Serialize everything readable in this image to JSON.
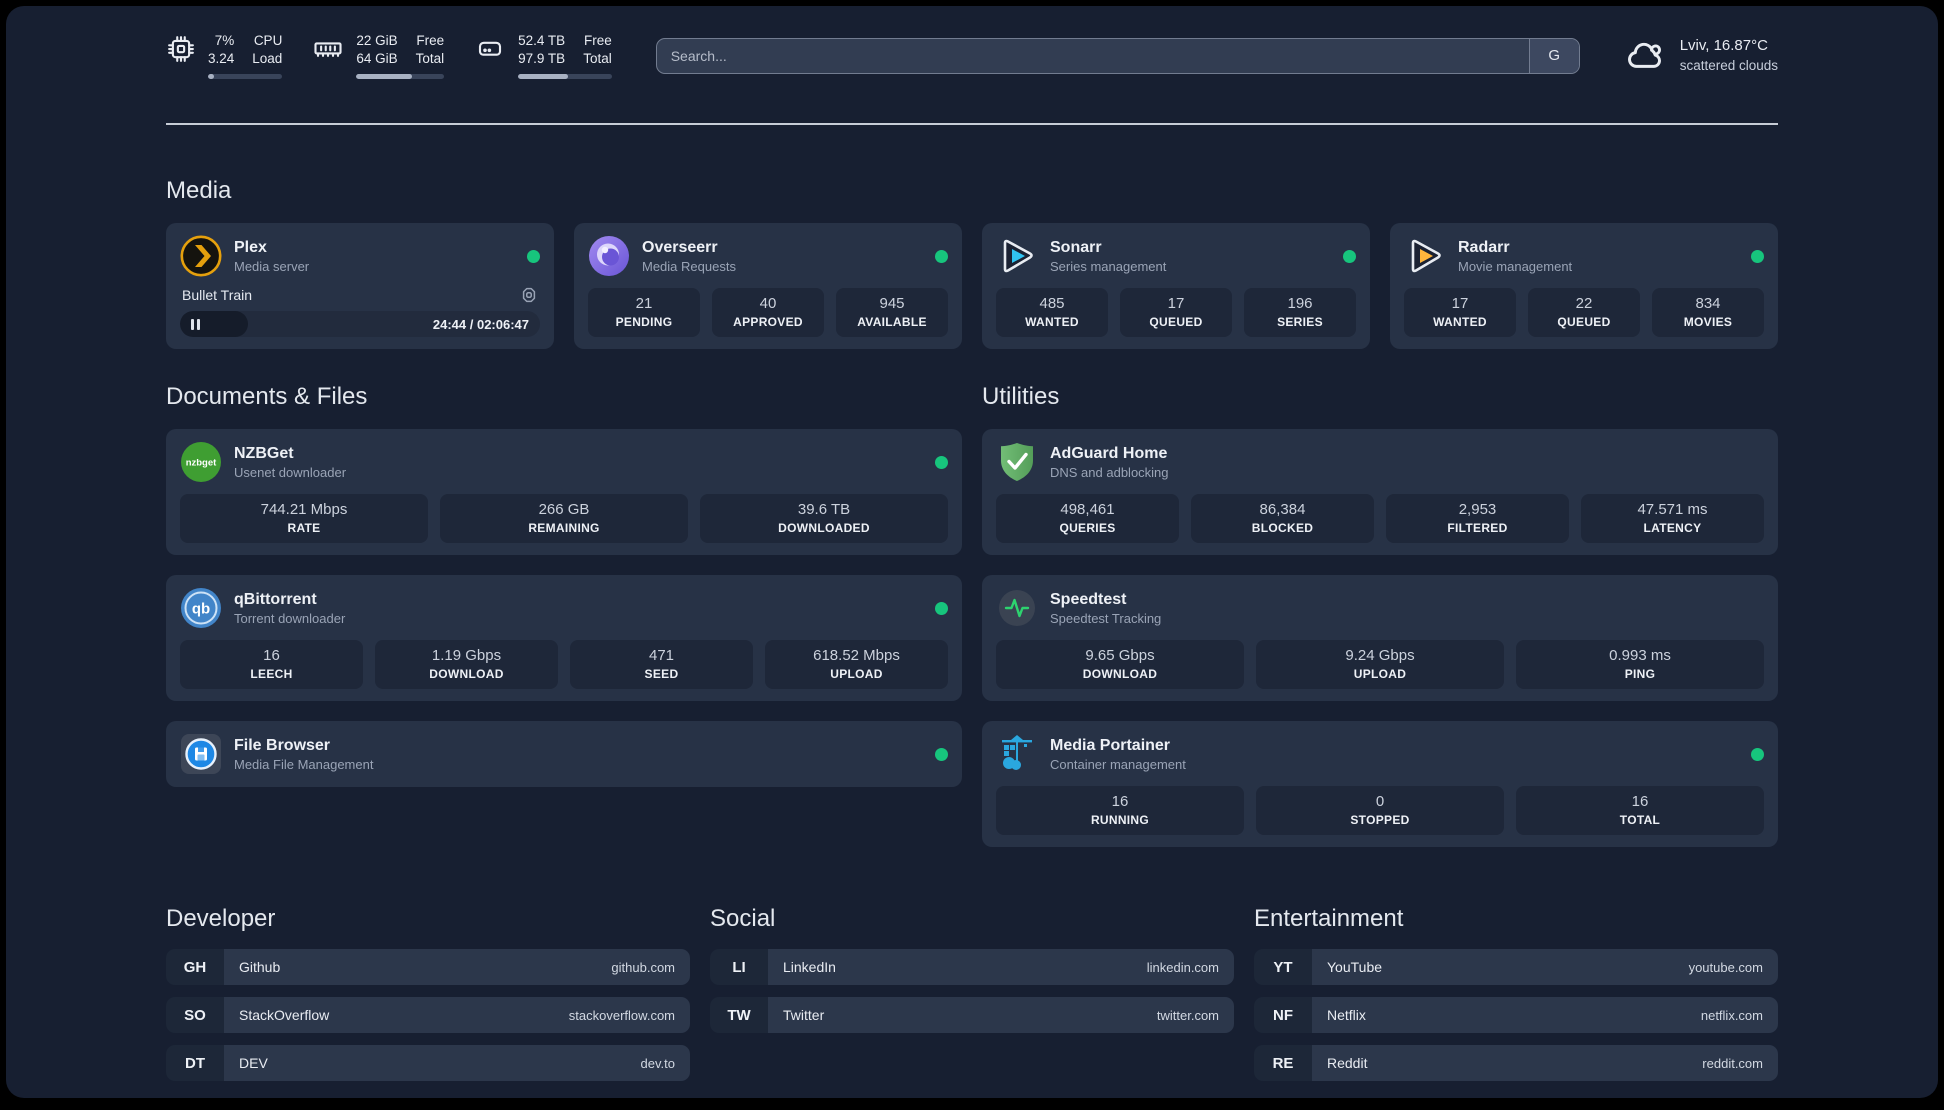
{
  "colors": {
    "background": "#171f31",
    "card": "#273246",
    "tile": "#1e2739",
    "status_green": "#17c57d",
    "plex_amber": "#e5a00d",
    "sonarr_cyan": "#30c4f2",
    "radarr_amber": "#ffb53c",
    "nzbget_green": "#3f9e32",
    "qbittorrent_blue": "#4285c9",
    "adguard_green": "#5fae63",
    "speedtest_green": "#2dd36f",
    "portainer_blue": "#2aa7df",
    "filebrowser_blue": "#1e88e5"
  },
  "topbar": {
    "cpu": {
      "icon": "cpu-icon",
      "v1": "7%",
      "v2": "3.24",
      "l1": "CPU",
      "l2": "Load",
      "progress": 8
    },
    "memory": {
      "icon": "ram-icon",
      "v1": "22 GiB",
      "v2": "64 GiB",
      "l1": "Free",
      "l2": "Total",
      "progress": 63
    },
    "disk": {
      "icon": "disk-icon",
      "v1": "52.4 TB",
      "v2": "97.9 TB",
      "l1": "Free",
      "l2": "Total",
      "progress": 53
    },
    "search": {
      "placeholder": "Search...",
      "button": "G"
    },
    "weather": {
      "line1": "Lviv, 16.87°C",
      "line2": "scattered clouds"
    }
  },
  "media": {
    "title": "Media",
    "plex": {
      "name": "Plex",
      "desc": "Media server",
      "player": {
        "title": "Bullet Train",
        "time": "24:44 / 02:06:47",
        "progress": 19
      }
    },
    "overseerr": {
      "name": "Overseerr",
      "desc": "Media Requests",
      "stats": [
        {
          "v": "21",
          "l": "PENDING"
        },
        {
          "v": "40",
          "l": "APPROVED"
        },
        {
          "v": "945",
          "l": "AVAILABLE"
        }
      ]
    },
    "sonarr": {
      "name": "Sonarr",
      "desc": "Series management",
      "stats": [
        {
          "v": "485",
          "l": "WANTED"
        },
        {
          "v": "17",
          "l": "QUEUED"
        },
        {
          "v": "196",
          "l": "SERIES"
        }
      ]
    },
    "radarr": {
      "name": "Radarr",
      "desc": "Movie management",
      "stats": [
        {
          "v": "17",
          "l": "WANTED"
        },
        {
          "v": "22",
          "l": "QUEUED"
        },
        {
          "v": "834",
          "l": "MOVIES"
        }
      ]
    }
  },
  "documents": {
    "title": "Documents & Files",
    "nzbget": {
      "name": "NZBGet",
      "desc": "Usenet downloader",
      "stats": [
        {
          "v": "744.21 Mbps",
          "l": "RATE"
        },
        {
          "v": "266 GB",
          "l": "REMAINING"
        },
        {
          "v": "39.6 TB",
          "l": "DOWNLOADED"
        }
      ]
    },
    "qbittorrent": {
      "name": "qBittorrent",
      "desc": "Torrent downloader",
      "stats": [
        {
          "v": "16",
          "l": "LEECH"
        },
        {
          "v": "1.19 Gbps",
          "l": "DOWNLOAD"
        },
        {
          "v": "471",
          "l": "SEED"
        },
        {
          "v": "618.52 Mbps",
          "l": "UPLOAD"
        }
      ]
    },
    "filebrowser": {
      "name": "File Browser",
      "desc": "Media File Management"
    }
  },
  "utilities": {
    "title": "Utilities",
    "adguard": {
      "name": "AdGuard Home",
      "desc": "DNS and adblocking",
      "stats": [
        {
          "v": "498,461",
          "l": "QUERIES"
        },
        {
          "v": "86,384",
          "l": "BLOCKED"
        },
        {
          "v": "2,953",
          "l": "FILTERED"
        },
        {
          "v": "47.571 ms",
          "l": "LATENCY"
        }
      ]
    },
    "speedtest": {
      "name": "Speedtest",
      "desc": "Speedtest Tracking",
      "stats": [
        {
          "v": "9.65 Gbps",
          "l": "DOWNLOAD"
        },
        {
          "v": "9.24 Gbps",
          "l": "UPLOAD"
        },
        {
          "v": "0.993 ms",
          "l": "PING"
        }
      ]
    },
    "portainer": {
      "name": "Media Portainer",
      "desc": "Container management",
      "stats": [
        {
          "v": "16",
          "l": "RUNNING"
        },
        {
          "v": "0",
          "l": "STOPPED"
        },
        {
          "v": "16",
          "l": "TOTAL"
        }
      ]
    }
  },
  "bookmarks": {
    "developer": {
      "title": "Developer",
      "items": [
        {
          "tag": "GH",
          "name": "Github",
          "url": "github.com"
        },
        {
          "tag": "SO",
          "name": "StackOverflow",
          "url": "stackoverflow.com"
        },
        {
          "tag": "DT",
          "name": "DEV",
          "url": "dev.to"
        }
      ]
    },
    "social": {
      "title": "Social",
      "items": [
        {
          "tag": "LI",
          "name": "LinkedIn",
          "url": "linkedin.com"
        },
        {
          "tag": "TW",
          "name": "Twitter",
          "url": "twitter.com"
        }
      ]
    },
    "entertainment": {
      "title": "Entertainment",
      "items": [
        {
          "tag": "YT",
          "name": "YouTube",
          "url": "youtube.com"
        },
        {
          "tag": "NF",
          "name": "Netflix",
          "url": "netflix.com"
        },
        {
          "tag": "RE",
          "name": "Reddit",
          "url": "reddit.com"
        }
      ]
    }
  }
}
